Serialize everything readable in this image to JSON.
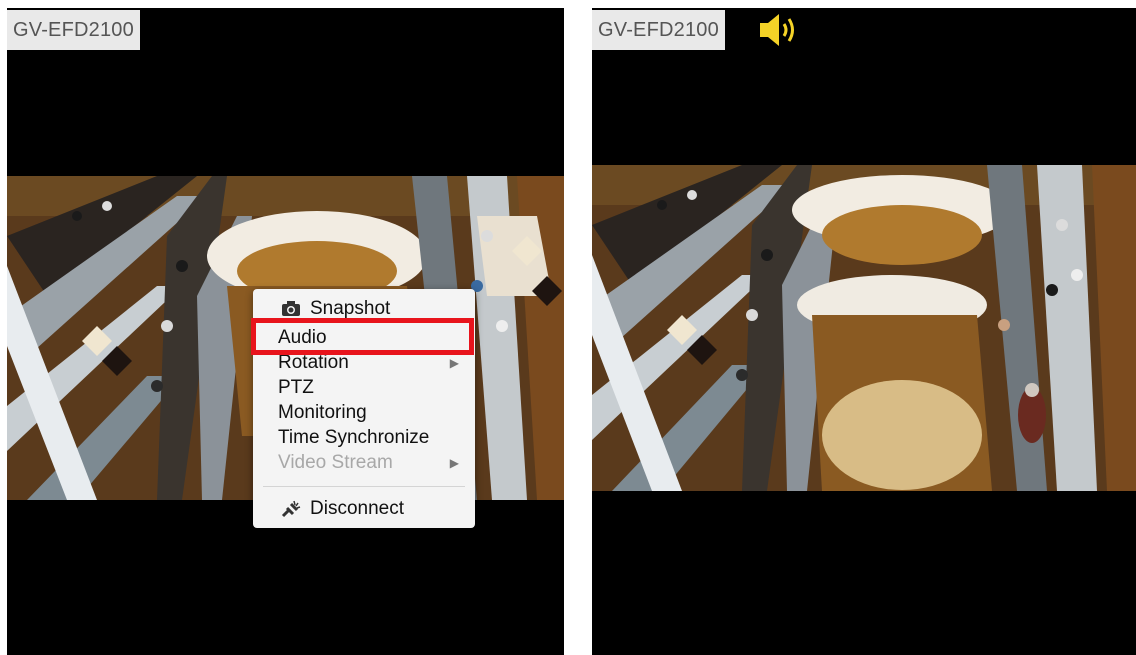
{
  "left_panel": {
    "camera_label": "GV-EFD2100",
    "video_icon": "mall-escalator-video-feed",
    "context_menu": {
      "items": [
        {
          "label": "Snapshot",
          "icon": "camera-icon"
        },
        {
          "label": "Audio"
        },
        {
          "label": "Rotation",
          "submenu": true
        },
        {
          "label": "PTZ"
        },
        {
          "label": "Monitoring"
        },
        {
          "label": "Time Synchronize"
        },
        {
          "label": "Video Stream",
          "submenu": true,
          "disabled": true
        },
        {
          "label": "Disconnect",
          "icon": "disconnect-icon"
        }
      ],
      "highlighted_item": "Audio",
      "highlight_color": "#e8141c"
    }
  },
  "right_panel": {
    "camera_label": "GV-EFD2100",
    "audio_icon": "speaker-icon",
    "audio_icon_color": "#f5d327",
    "video_icon": "mall-escalator-video-feed"
  }
}
